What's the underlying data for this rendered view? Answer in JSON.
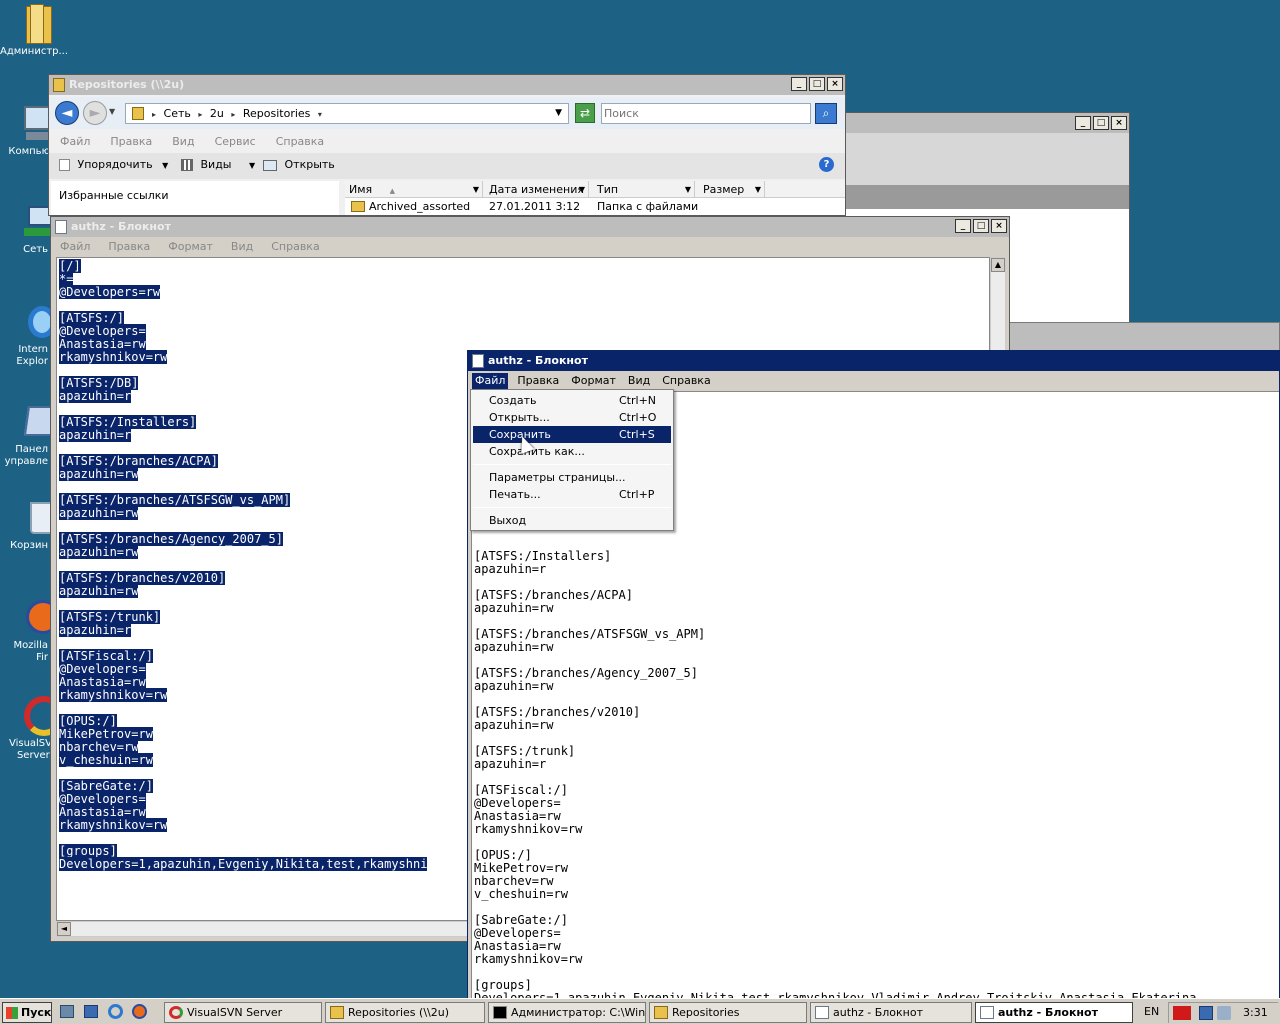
{
  "desktop": {
    "icons": [
      {
        "label": "Администр..."
      },
      {
        "label": "Компью"
      },
      {
        "label": "Сеть"
      },
      {
        "label": "Intern\nExplor"
      },
      {
        "label": "Панел\nуправле"
      },
      {
        "label": "Корзин"
      },
      {
        "label": "Mozilla Fir"
      },
      {
        "label": "VisualSV\nServer."
      }
    ]
  },
  "explorer": {
    "title": "Repositories (\\\\2u)",
    "breadcrumb": [
      "Сеть",
      "2u",
      "Repositories"
    ],
    "search_placeholder": "Поиск",
    "menu": [
      "Файл",
      "Правка",
      "Вид",
      "Сервис",
      "Справка"
    ],
    "toolbar": {
      "organize": "Упорядочить",
      "views": "Виды",
      "open": "Открыть"
    },
    "favorites": "Избранные ссылки",
    "columns": [
      "Имя",
      "Дата изменения",
      "Тип",
      "Размер"
    ],
    "rows": [
      {
        "name": "Archived_assorted",
        "date": "27.01.2011 3:12",
        "type": "Папка с файлами",
        "size": ""
      }
    ]
  },
  "notepad_back": {
    "title": "authz - Блокнот",
    "menu": [
      "Файл",
      "Правка",
      "Формат",
      "Вид",
      "Справка"
    ],
    "lines": [
      "[/]",
      "*=",
      "@Developers=rw",
      "",
      "[ATSFS:/]",
      "@Developers=",
      "Anastasia=rw",
      "rkamyshnikov=rw",
      "",
      "[ATSFS:/DB]",
      "apazuhin=r",
      "",
      "[ATSFS:/Installers]",
      "apazuhin=r",
      "",
      "[ATSFS:/branches/ACPA]",
      "apazuhin=rw",
      "",
      "[ATSFS:/branches/ATSFSGW_vs_APM]",
      "apazuhin=rw",
      "",
      "[ATSFS:/branches/Agency_2007_5]",
      "apazuhin=rw",
      "",
      "[ATSFS:/branches/v2010]",
      "apazuhin=rw",
      "",
      "[ATSFS:/trunk]",
      "apazuhin=r",
      "",
      "[ATSFiscal:/]",
      "@Developers=",
      "Anastasia=rw",
      "rkamyshnikov=rw",
      "",
      "[OPUS:/]",
      "MikePetrov=rw",
      "nbarchev=rw",
      "v_cheshuin=rw",
      "",
      "[SabreGate:/]",
      "@Developers=",
      "Anastasia=rw",
      "rkamyshnikov=rw",
      "",
      "[groups]",
      "Developers=1,apazuhin,Evgeniy,Nikita,test,rkamyshni"
    ]
  },
  "notepad_front": {
    "title": "authz - Блокнот",
    "menu": [
      "Файл",
      "Правка",
      "Формат",
      "Вид",
      "Справка"
    ],
    "lines": [
      "[ATSFS:/Installers]",
      "apazuhin=r",
      "",
      "[ATSFS:/branches/ACPA]",
      "apazuhin=rw",
      "",
      "[ATSFS:/branches/ATSFSGW_vs_APM]",
      "apazuhin=rw",
      "",
      "[ATSFS:/branches/Agency_2007_5]",
      "apazuhin=rw",
      "",
      "[ATSFS:/branches/v2010]",
      "apazuhin=rw",
      "",
      "[ATSFS:/trunk]",
      "apazuhin=r",
      "",
      "[ATSFiscal:/]",
      "@Developers=",
      "Anastasia=rw",
      "rkamyshnikov=rw",
      "",
      "[OPUS:/]",
      "MikePetrov=rw",
      "nbarchev=rw",
      "v_cheshuin=rw",
      "",
      "[SabreGate:/]",
      "@Developers=",
      "Anastasia=rw",
      "rkamyshnikov=rw",
      "",
      "[groups]",
      "Developers=1,apazuhin,Evgeniy,Nikita,test,rkamyshnikov,Vladimir,Andrey,Troitskiy,Anastasia,Ekaterina"
    ],
    "file_menu": [
      {
        "label": "Создать",
        "shortcut": "Ctrl+N"
      },
      {
        "label": "Открыть...",
        "shortcut": "Ctrl+O"
      },
      {
        "label": "Сохранить",
        "shortcut": "Ctrl+S",
        "selected": true
      },
      {
        "label": "Сохранить как...",
        "shortcut": ""
      },
      {
        "separator": true
      },
      {
        "label": "Параметры страницы...",
        "shortcut": ""
      },
      {
        "label": "Печать...",
        "shortcut": "Ctrl+P"
      },
      {
        "separator": true
      },
      {
        "label": "Выход",
        "shortcut": ""
      }
    ]
  },
  "taskbar": {
    "start": "Пуск",
    "tasks": [
      {
        "label": "VisualSVN Server",
        "active": false
      },
      {
        "label": "Repositories (\\\\2u)",
        "active": false
      },
      {
        "label": "Администратор: C:\\Win...",
        "active": false
      },
      {
        "label": "Repositories",
        "active": false
      },
      {
        "label": "authz - Блокнот",
        "active": false
      },
      {
        "label": "authz - Блокнот",
        "active": true
      }
    ],
    "lang": "EN",
    "clock": "3:31"
  },
  "colors": {
    "desktop": "#1d6285",
    "selection": "#0a246a",
    "title_active": "#0a246a"
  }
}
